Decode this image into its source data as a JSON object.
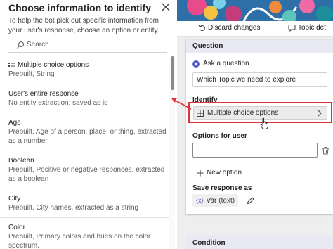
{
  "panel": {
    "title": "Choose information to identify",
    "description": "To help the bot pick out specific information from your user's response, choose an option or entity.",
    "search_placeholder": "Search",
    "items": [
      {
        "title": "Multiple choice options",
        "subtitle": "Prebuilt, String",
        "icon": "list-icon"
      },
      {
        "title": "User's entire response",
        "subtitle": "No entity extraction; saved as is"
      },
      {
        "title": "Age",
        "subtitle": "Prebuilt, Age of a person, place, or thing, extracted as a number"
      },
      {
        "title": "Boolean",
        "subtitle": "Prebuilt, Positive or negative responses, extracted as a boolean"
      },
      {
        "title": "City",
        "subtitle": "Prebuilt, City names, extracted as a string"
      },
      {
        "title": "Color",
        "subtitle": "Prebuilt, Primary colors and hues on the color spectrum,"
      }
    ]
  },
  "toolbar": {
    "discard_label": "Discard changes",
    "topic_label": "Topic det"
  },
  "question_card": {
    "header": "Question",
    "ask_label": "Ask a question",
    "question_text": "Which Topic we need to explore",
    "identify_label": "Identify",
    "identify_value": "Multiple choice options",
    "options_label": "Options for user",
    "new_option_label": "New option",
    "save_label": "Save response as",
    "var_prefix": "{x}",
    "var_name": "Var",
    "var_type": "(text)"
  },
  "condition_card": {
    "header": "Condition"
  },
  "colors": {
    "highlight": "#e0323b",
    "accent": "#5b5fc7",
    "card_header": "#e9e9f4"
  }
}
